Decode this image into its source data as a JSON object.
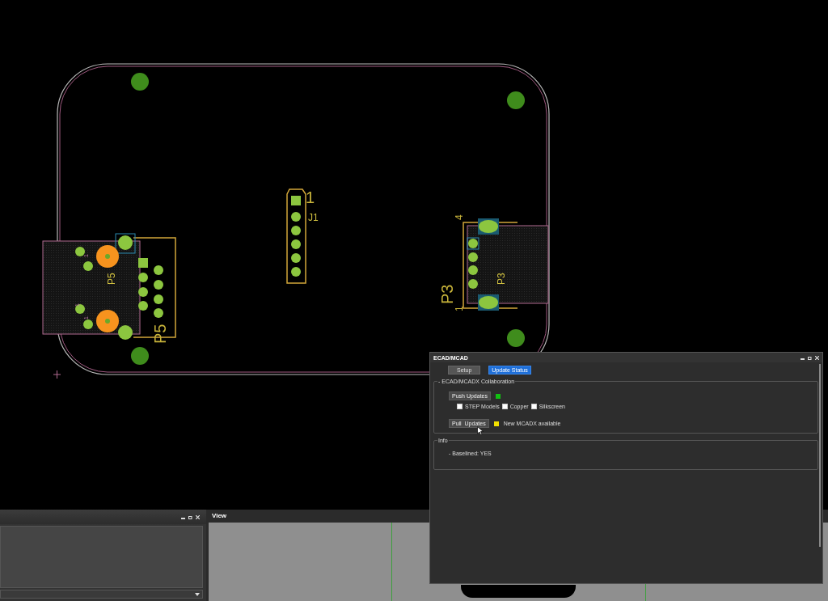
{
  "pcb": {
    "labels": [
      {
        "kind": "designator",
        "text": "P5"
      },
      {
        "kind": "ref",
        "text": "P5"
      },
      {
        "kind": "designator",
        "text": "1"
      },
      {
        "kind": "ref",
        "text": "J1"
      },
      {
        "kind": "ref",
        "text": "P3"
      },
      {
        "kind": "designator",
        "text": "P3"
      },
      {
        "kind": "pin",
        "text": "4"
      },
      {
        "kind": "pin",
        "text": "1"
      },
      {
        "kind": "mark",
        "text": "1"
      },
      {
        "kind": "mark",
        "text": "1"
      },
      {
        "kind": "mark",
        "text": "1"
      }
    ]
  },
  "view_panel": {
    "title": "View"
  },
  "ecad_window": {
    "title": "ECAD/MCAD",
    "tabs": [
      {
        "label": "Setup",
        "selected": false
      },
      {
        "label": "Update Status",
        "selected": true
      }
    ],
    "collaboration": {
      "title": "- ECAD/MCADX Collaboration",
      "push_button": "Push Updates",
      "push_status": {
        "color": "#11c011"
      },
      "options": [
        {
          "label": "STEP Models",
          "checked": false
        },
        {
          "label": "Copper",
          "checked": false
        },
        {
          "label": "Silkscreen",
          "checked": false
        }
      ],
      "pull_button": "Pull  Updates",
      "pull_status": {
        "color": "#f2e100"
      },
      "pull_status_text": "New MCADX available"
    },
    "info": {
      "title": "Info",
      "lines": [
        "- Baselined: YES"
      ]
    }
  }
}
